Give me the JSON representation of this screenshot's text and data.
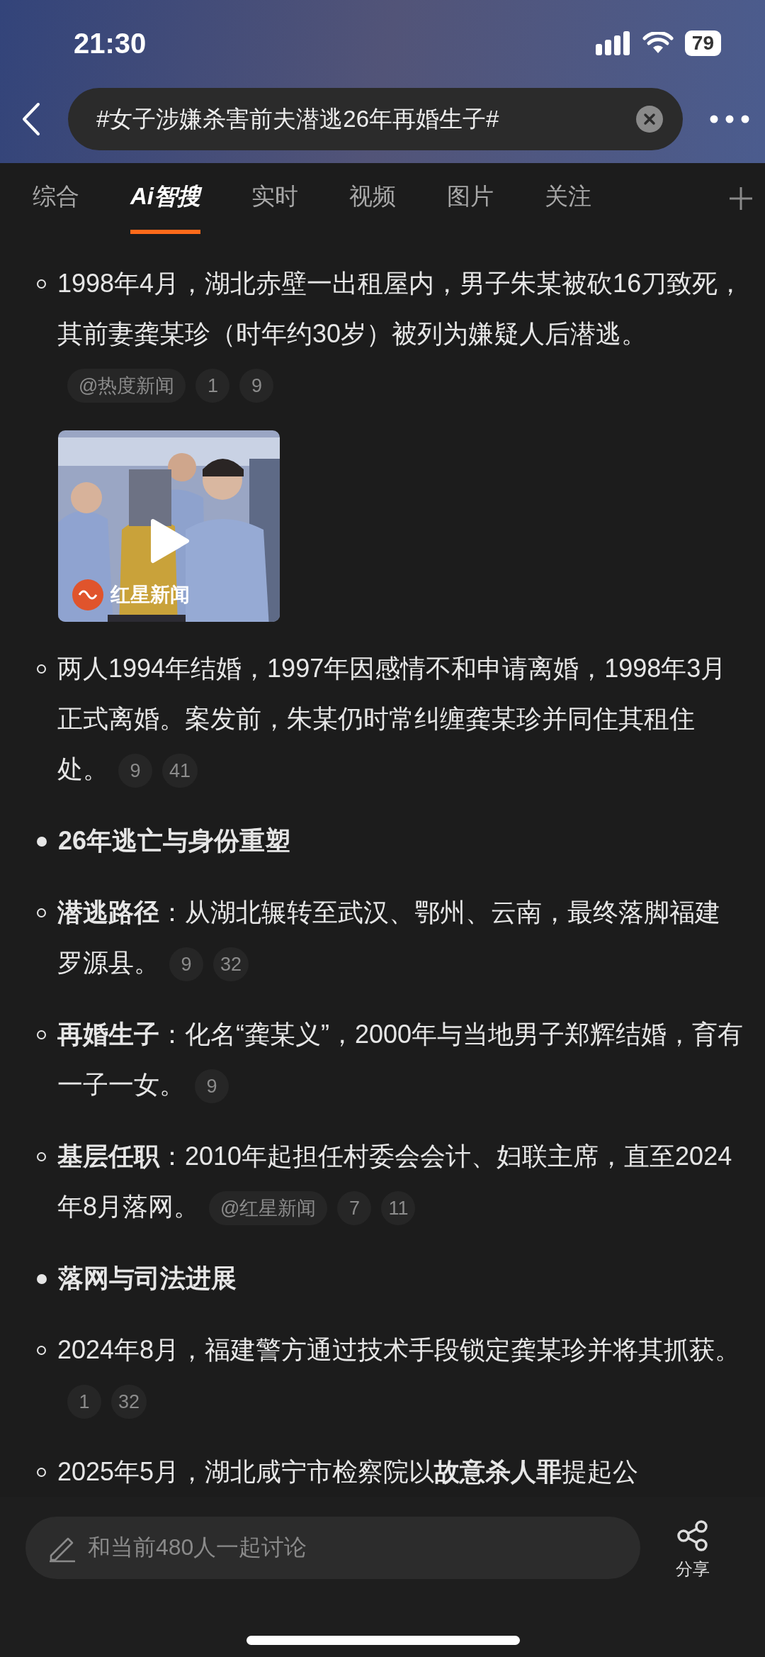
{
  "status_bar": {
    "time": "21:30",
    "battery": "79"
  },
  "search": {
    "query": "#女子涉嫌杀害前夫潜逃26年再婚生子#"
  },
  "tabs": [
    {
      "label": "综合",
      "selected": false
    },
    {
      "label": "Ai智搜",
      "selected": true
    },
    {
      "label": "实时",
      "selected": false
    },
    {
      "label": "视频",
      "selected": false
    },
    {
      "label": "图片",
      "selected": false
    },
    {
      "label": "关注",
      "selected": false
    }
  ],
  "content": [
    {
      "kind": "point",
      "text": "1998年4月，湖北赤壁一出租屋内，男子朱某被砍16刀致死，其前妻龚某珍（时年约30岁）被列为嫌疑人后潜逃。",
      "chips": [
        {
          "kind": "source",
          "text": "@热度新闻"
        },
        {
          "kind": "ref",
          "text": "1"
        },
        {
          "kind": "ref",
          "text": "9"
        }
      ]
    },
    {
      "kind": "video",
      "source": "红星新闻"
    },
    {
      "kind": "point",
      "text": "两人1994年结婚，1997年因感情不和申请离婚，1998年3月正式离婚。案发前，朱某仍时常纠缠龚某珍并同住其租住处。",
      "chips": [
        {
          "kind": "ref",
          "text": "9"
        },
        {
          "kind": "ref",
          "text": "41"
        }
      ]
    },
    {
      "kind": "heading",
      "text": "26年逃亡与身份重塑"
    },
    {
      "kind": "point",
      "text": "**潜逃路径**：从湖北辗转至武汉、鄂州、云南，最终落脚福建罗源县。",
      "chips": [
        {
          "kind": "ref",
          "text": "9"
        },
        {
          "kind": "ref",
          "text": "32"
        }
      ]
    },
    {
      "kind": "point",
      "text": "**再婚生子**：化名“龚某义”，2000年与当地男子郑辉结婚，育有一子一女。",
      "chips": [
        {
          "kind": "ref",
          "text": "9"
        }
      ]
    },
    {
      "kind": "point",
      "text": "**基层任职**：2010年起担任村委会会计、妇联主席，直至2024年8月落网。",
      "chips": [
        {
          "kind": "source",
          "text": "@红星新闻"
        },
        {
          "kind": "ref",
          "text": "7"
        },
        {
          "kind": "ref",
          "text": "11"
        }
      ]
    },
    {
      "kind": "heading",
      "text": "落网与司法进展"
    },
    {
      "kind": "point",
      "text": "2024年8月，福建警方通过技术手段锁定龚某珍并将其抓获。",
      "chips": [
        {
          "kind": "ref",
          "text": "1"
        },
        {
          "kind": "ref",
          "text": "32"
        }
      ]
    },
    {
      "kind": "point",
      "text": "2025年5月，湖北咸宁市检察院以**故意杀人罪**提起公"
    }
  ],
  "composer": {
    "placeholder": "和当前480人一起讨论"
  },
  "share": {
    "label": "分享"
  }
}
